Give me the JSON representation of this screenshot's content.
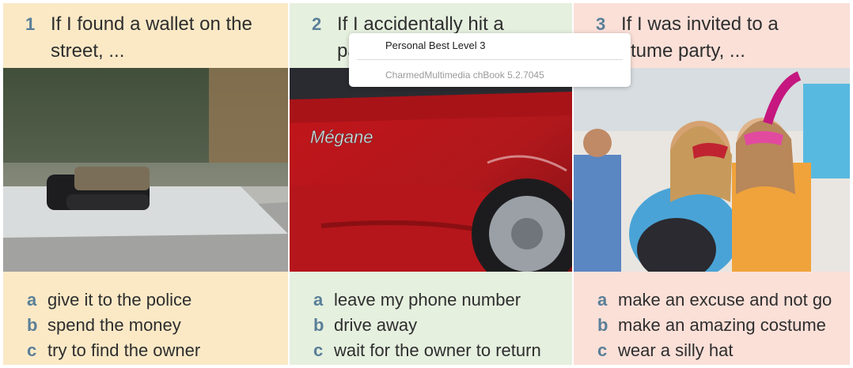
{
  "panels": [
    {
      "number": "1",
      "question_line1": "If I found a wallet on the",
      "question_line2": "street, ...",
      "photo_icon": "wallet-photo",
      "answers": [
        {
          "letter": "a",
          "text": "give it to the police"
        },
        {
          "letter": "b",
          "text": "spend the money"
        },
        {
          "letter": "c",
          "text": "try to find the owner"
        }
      ]
    },
    {
      "number": "2",
      "question_line1": "If I accidentally hit a",
      "question_line2": "pa",
      "photo_icon": "red-car-photo",
      "car_badge": "Mégane",
      "answers": [
        {
          "letter": "a",
          "text": "leave my phone number"
        },
        {
          "letter": "b",
          "text": "drive away"
        },
        {
          "letter": "c",
          "text": "wait for the owner to return"
        }
      ]
    },
    {
      "number": "3",
      "question_line1": "If I was invited to a",
      "question_line2": "stume party, ...",
      "photo_icon": "costume-party-photo",
      "answers": [
        {
          "letter": "a",
          "text": "make an excuse and not go"
        },
        {
          "letter": "b",
          "text": "make an amazing costume"
        },
        {
          "letter": "c",
          "text": "wear a silly hat"
        }
      ]
    }
  ],
  "popup": {
    "title": "Personal Best Level 3",
    "subtitle": "CharmedMultimedia chBook 5.2.7045"
  },
  "colors": {
    "panel1_bg": "#fbe9c6",
    "panel2_bg": "#e6f0df",
    "panel3_bg": "#fbe0d8",
    "accent": "#5a7f98"
  }
}
